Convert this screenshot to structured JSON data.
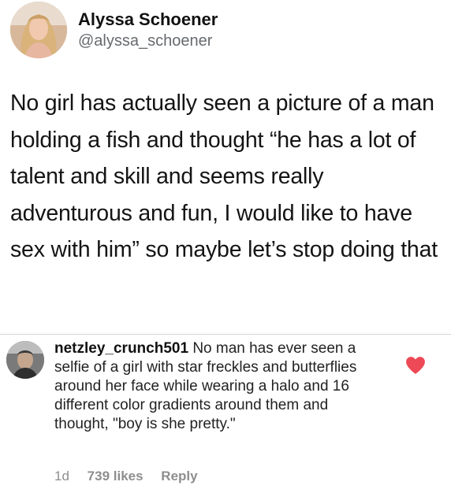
{
  "tweet": {
    "author_name": "Alyssa Schoener",
    "author_handle": "@alyssa_schoener",
    "text": "No girl has actually seen a picture of a man holding a fish and thought “he has a lot of talent and skill and seems really adventurous and fun, I would like to have sex with him” so maybe let’s stop doing that"
  },
  "comment": {
    "username": "netzley_crunch501",
    "text": "No man has ever seen a selfie of a girl with star freckles and butterflies around her face while wearing a halo and 16 different color gradients around them and thought, \"boy is she pretty.\"",
    "time": "1d",
    "likes": "739 likes",
    "reply_label": "Reply",
    "like_icon": "heart-icon",
    "like_color": "#ed4956"
  },
  "colors": {
    "background": "#ffffff",
    "handle_gray": "#666a6e",
    "meta_gray": "#8e8e8e",
    "divider": "#d6d6d6"
  }
}
